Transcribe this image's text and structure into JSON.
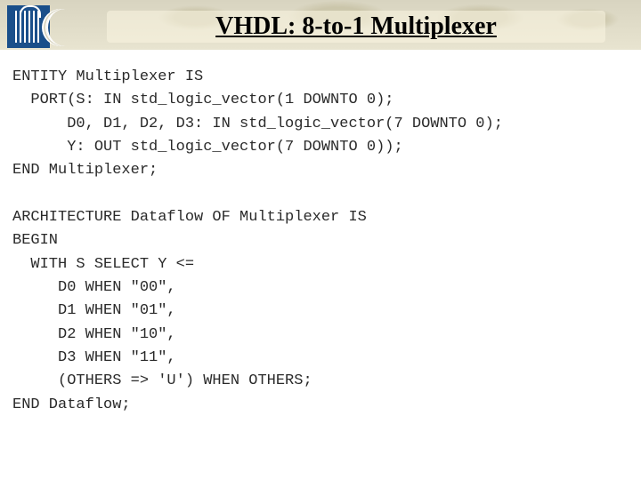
{
  "title": "VHDL: 8-to-1 Multiplexer",
  "code": {
    "l1": "ENTITY Multiplexer IS",
    "l2": "  PORT(S: IN std_logic_vector(1 DOWNTO 0);",
    "l3": "      D0, D1, D2, D3: IN std_logic_vector(7 DOWNTO 0);",
    "l4": "      Y: OUT std_logic_vector(7 DOWNTO 0));",
    "l5": "END Multiplexer;",
    "l6": "",
    "l7": "ARCHITECTURE Dataflow OF Multiplexer IS",
    "l8": "BEGIN",
    "l9": "  WITH S SELECT Y <=",
    "l10": "     D0 WHEN \"00\",",
    "l11": "     D1 WHEN \"01\",",
    "l12": "     D2 WHEN \"10\",",
    "l13": "     D3 WHEN \"11\",",
    "l14": "     (OTHERS => 'U') WHEN OTHERS;",
    "l15": "END Dataflow;"
  }
}
